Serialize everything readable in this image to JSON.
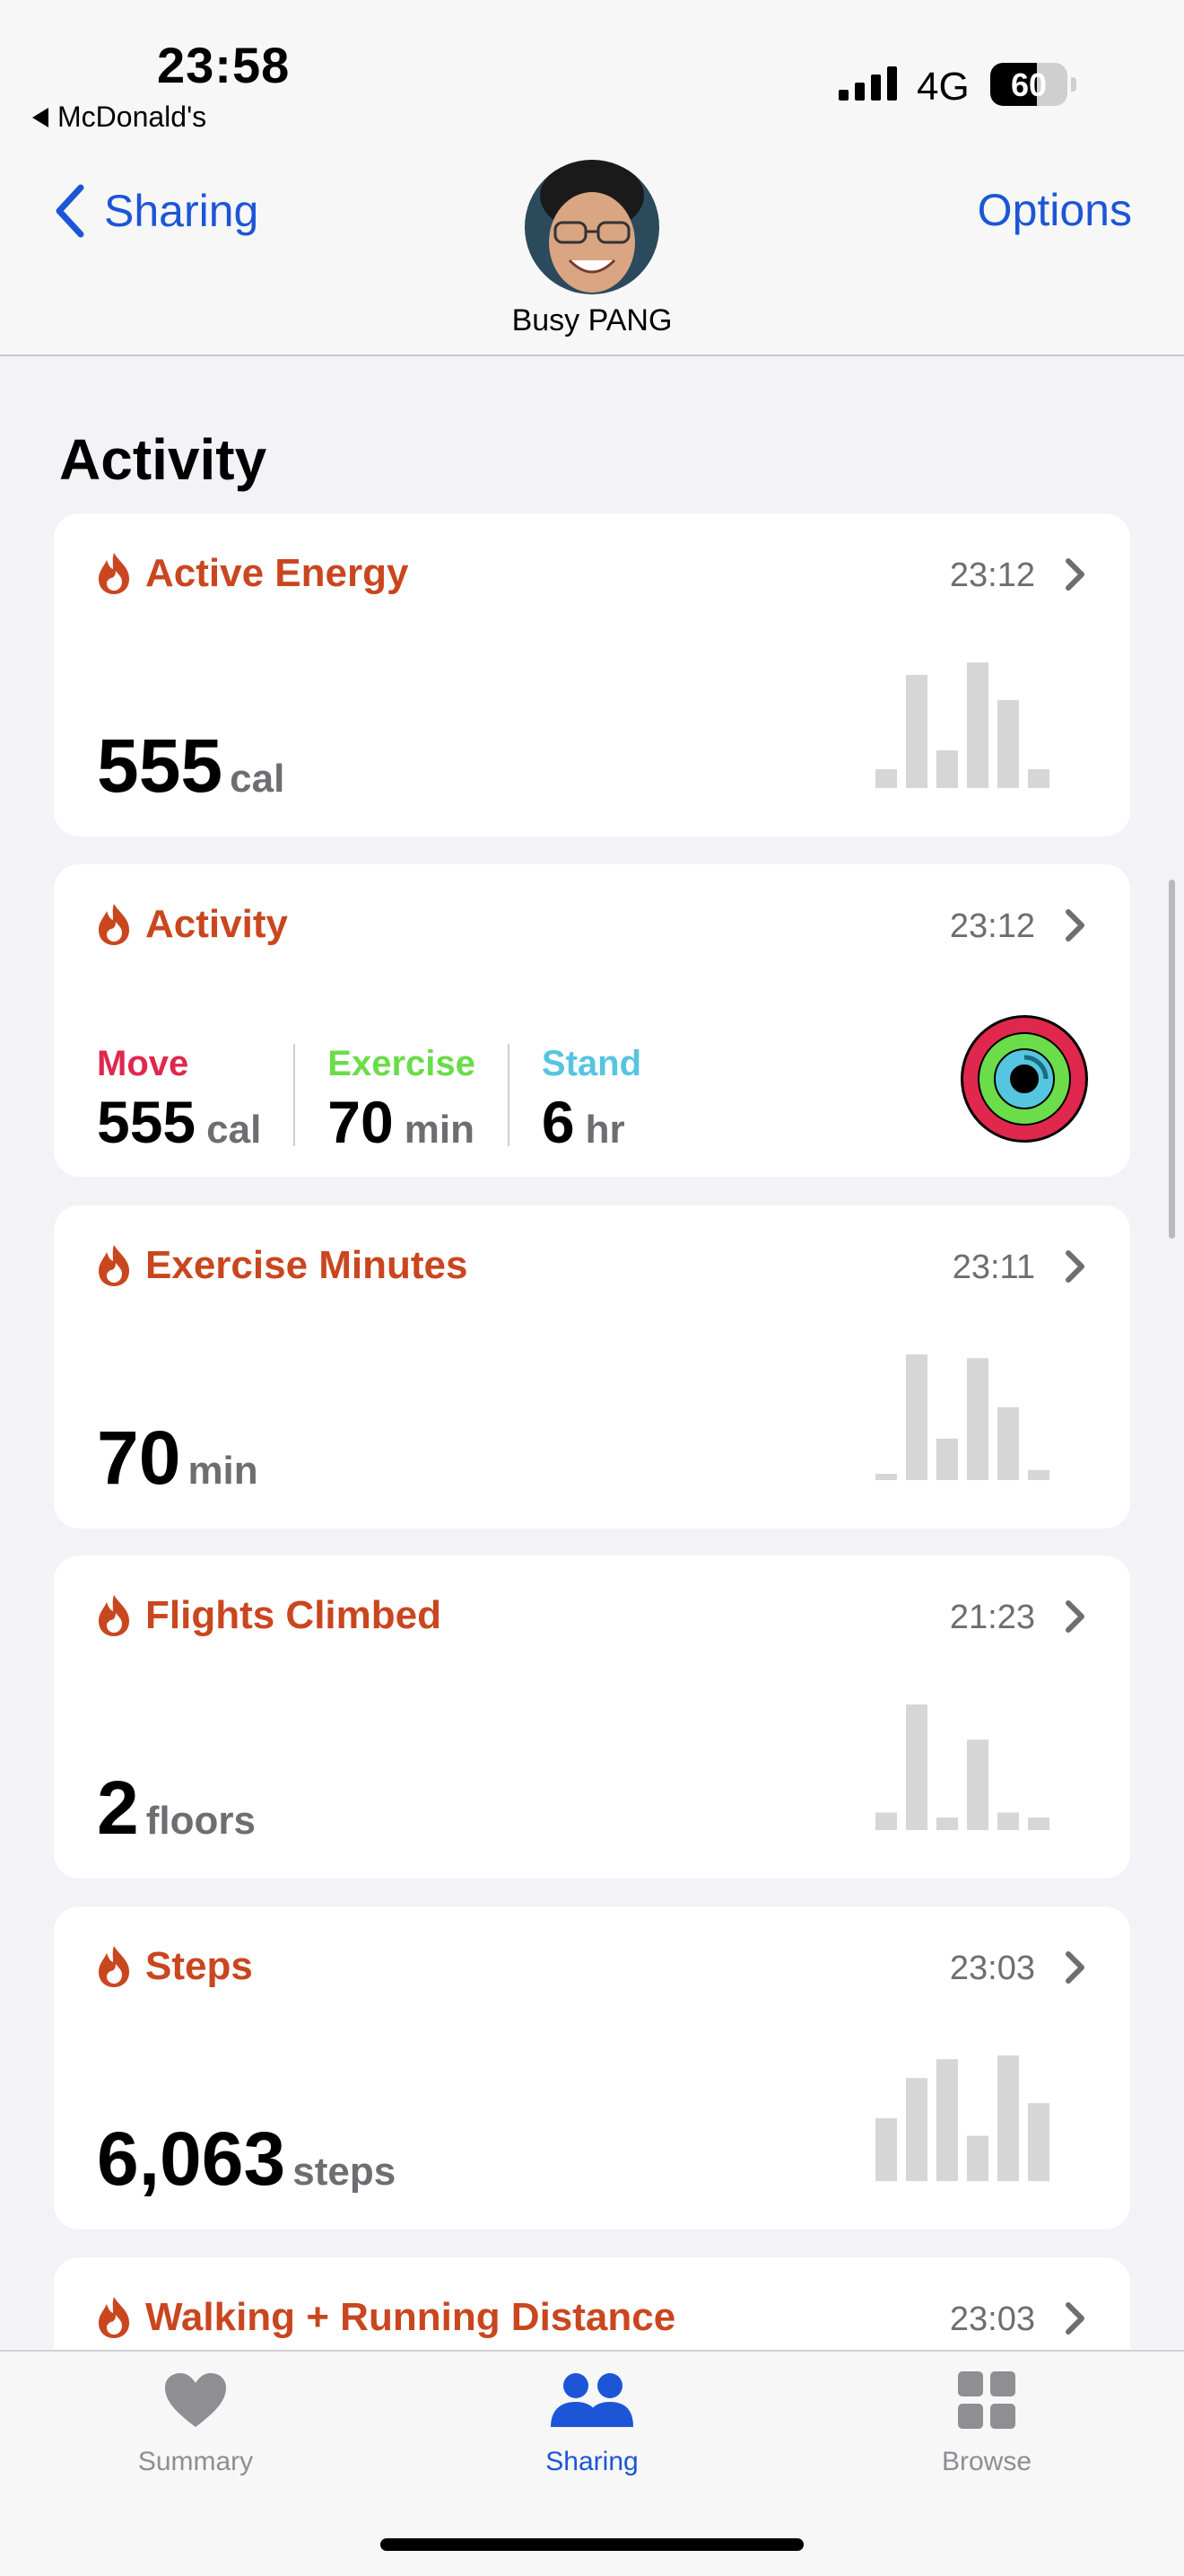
{
  "status": {
    "time": "23:58",
    "back_app": "McDonald's",
    "network": "4G",
    "battery": "60",
    "battery_level": 0.6
  },
  "nav": {
    "back_label": "Sharing",
    "options_label": "Options",
    "contact_name": "Busy PANG"
  },
  "section_title": "Activity",
  "cards": [
    {
      "title": "Active Energy",
      "time": "23:12",
      "value": "555",
      "unit": "cal",
      "bars": [
        0.15,
        0.9,
        0.3,
        1.0,
        0.7,
        0.15
      ]
    },
    {
      "title": "Activity",
      "time": "23:12",
      "rings": [
        {
          "label": "Move",
          "value": "555",
          "unit": "cal",
          "color": "#e0274d"
        },
        {
          "label": "Exercise",
          "value": "70",
          "unit": "min",
          "color": "#6bdc4a"
        },
        {
          "label": "Stand",
          "value": "6",
          "unit": "hr",
          "color": "#55c5e0"
        }
      ]
    },
    {
      "title": "Exercise Minutes",
      "time": "23:11",
      "value": "70",
      "unit": "min",
      "bars": [
        0.05,
        1.0,
        0.33,
        0.97,
        0.58,
        0.08
      ]
    },
    {
      "title": "Flights Climbed",
      "time": "21:23",
      "value": "2",
      "unit": "floors",
      "bars": [
        0.14,
        1.0,
        0.1,
        0.72,
        0.14,
        0.1
      ]
    },
    {
      "title": "Steps",
      "time": "23:03",
      "value": "6,063",
      "unit": "steps",
      "bars": [
        0.5,
        0.82,
        0.97,
        0.36,
        1.0,
        0.62
      ]
    },
    {
      "title": "Walking + Running Distance",
      "time": "23:03"
    }
  ],
  "tabs": [
    {
      "label": "Summary",
      "icon": "heart-icon"
    },
    {
      "label": "Sharing",
      "icon": "people-icon",
      "active": true
    },
    {
      "label": "Browse",
      "icon": "grid-icon"
    }
  ],
  "colors": {
    "accent": "#1c56d6",
    "activity": "#c9461f",
    "bar": "#d6d6d6"
  }
}
